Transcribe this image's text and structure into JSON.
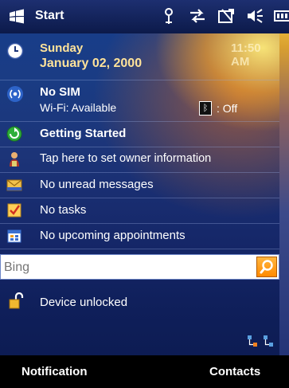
{
  "titlebar": {
    "start_label": "Start",
    "icons": [
      "antenna-icon",
      "sync-icon",
      "no-signal-icon",
      "volume-icon",
      "battery-icon"
    ]
  },
  "today": {
    "day": "Sunday",
    "date": "January 02, 2000",
    "time": "11:50 AM"
  },
  "connectivity": {
    "sim": "No SIM",
    "wifi": "Wi-Fi: Available",
    "bluetooth": ": Off"
  },
  "items": {
    "getting_started": "Getting Started",
    "owner": "Tap here to set owner information",
    "messages": "No unread messages",
    "tasks": "No tasks",
    "appointments": "No upcoming appointments"
  },
  "search": {
    "placeholder": "Bing"
  },
  "lock": {
    "label": "Device unlocked"
  },
  "softkeys": {
    "left": "Notification",
    "right": "Contacts"
  },
  "colors": {
    "accent": "#ff9a00",
    "date_text": "#ffe39a",
    "softkey_bg": "#000000"
  }
}
